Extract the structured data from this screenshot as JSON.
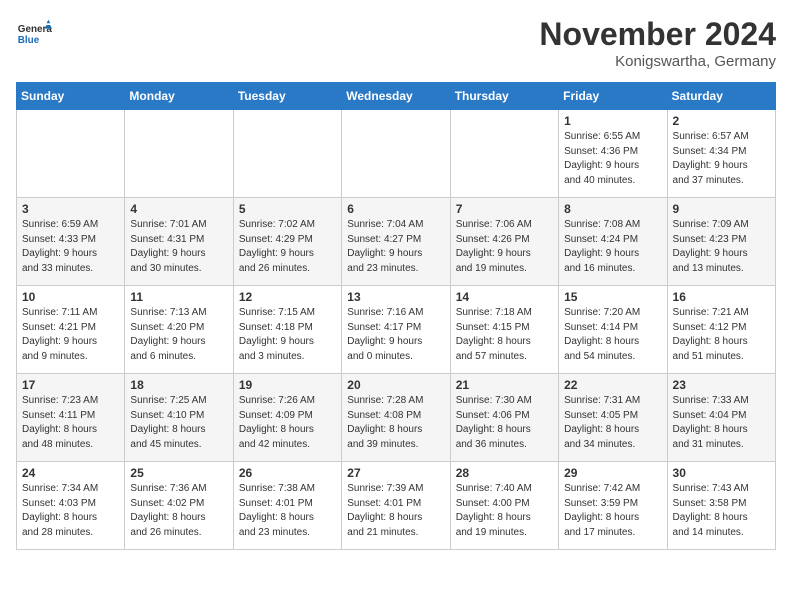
{
  "header": {
    "logo_general": "General",
    "logo_blue": "Blue",
    "month_title": "November 2024",
    "location": "Konigswartha, Germany"
  },
  "weekdays": [
    "Sunday",
    "Monday",
    "Tuesday",
    "Wednesday",
    "Thursday",
    "Friday",
    "Saturday"
  ],
  "weeks": [
    [
      {
        "day": "",
        "info": ""
      },
      {
        "day": "",
        "info": ""
      },
      {
        "day": "",
        "info": ""
      },
      {
        "day": "",
        "info": ""
      },
      {
        "day": "",
        "info": ""
      },
      {
        "day": "1",
        "info": "Sunrise: 6:55 AM\nSunset: 4:36 PM\nDaylight: 9 hours\nand 40 minutes."
      },
      {
        "day": "2",
        "info": "Sunrise: 6:57 AM\nSunset: 4:34 PM\nDaylight: 9 hours\nand 37 minutes."
      }
    ],
    [
      {
        "day": "3",
        "info": "Sunrise: 6:59 AM\nSunset: 4:33 PM\nDaylight: 9 hours\nand 33 minutes."
      },
      {
        "day": "4",
        "info": "Sunrise: 7:01 AM\nSunset: 4:31 PM\nDaylight: 9 hours\nand 30 minutes."
      },
      {
        "day": "5",
        "info": "Sunrise: 7:02 AM\nSunset: 4:29 PM\nDaylight: 9 hours\nand 26 minutes."
      },
      {
        "day": "6",
        "info": "Sunrise: 7:04 AM\nSunset: 4:27 PM\nDaylight: 9 hours\nand 23 minutes."
      },
      {
        "day": "7",
        "info": "Sunrise: 7:06 AM\nSunset: 4:26 PM\nDaylight: 9 hours\nand 19 minutes."
      },
      {
        "day": "8",
        "info": "Sunrise: 7:08 AM\nSunset: 4:24 PM\nDaylight: 9 hours\nand 16 minutes."
      },
      {
        "day": "9",
        "info": "Sunrise: 7:09 AM\nSunset: 4:23 PM\nDaylight: 9 hours\nand 13 minutes."
      }
    ],
    [
      {
        "day": "10",
        "info": "Sunrise: 7:11 AM\nSunset: 4:21 PM\nDaylight: 9 hours\nand 9 minutes."
      },
      {
        "day": "11",
        "info": "Sunrise: 7:13 AM\nSunset: 4:20 PM\nDaylight: 9 hours\nand 6 minutes."
      },
      {
        "day": "12",
        "info": "Sunrise: 7:15 AM\nSunset: 4:18 PM\nDaylight: 9 hours\nand 3 minutes."
      },
      {
        "day": "13",
        "info": "Sunrise: 7:16 AM\nSunset: 4:17 PM\nDaylight: 9 hours\nand 0 minutes."
      },
      {
        "day": "14",
        "info": "Sunrise: 7:18 AM\nSunset: 4:15 PM\nDaylight: 8 hours\nand 57 minutes."
      },
      {
        "day": "15",
        "info": "Sunrise: 7:20 AM\nSunset: 4:14 PM\nDaylight: 8 hours\nand 54 minutes."
      },
      {
        "day": "16",
        "info": "Sunrise: 7:21 AM\nSunset: 4:12 PM\nDaylight: 8 hours\nand 51 minutes."
      }
    ],
    [
      {
        "day": "17",
        "info": "Sunrise: 7:23 AM\nSunset: 4:11 PM\nDaylight: 8 hours\nand 48 minutes."
      },
      {
        "day": "18",
        "info": "Sunrise: 7:25 AM\nSunset: 4:10 PM\nDaylight: 8 hours\nand 45 minutes."
      },
      {
        "day": "19",
        "info": "Sunrise: 7:26 AM\nSunset: 4:09 PM\nDaylight: 8 hours\nand 42 minutes."
      },
      {
        "day": "20",
        "info": "Sunrise: 7:28 AM\nSunset: 4:08 PM\nDaylight: 8 hours\nand 39 minutes."
      },
      {
        "day": "21",
        "info": "Sunrise: 7:30 AM\nSunset: 4:06 PM\nDaylight: 8 hours\nand 36 minutes."
      },
      {
        "day": "22",
        "info": "Sunrise: 7:31 AM\nSunset: 4:05 PM\nDaylight: 8 hours\nand 34 minutes."
      },
      {
        "day": "23",
        "info": "Sunrise: 7:33 AM\nSunset: 4:04 PM\nDaylight: 8 hours\nand 31 minutes."
      }
    ],
    [
      {
        "day": "24",
        "info": "Sunrise: 7:34 AM\nSunset: 4:03 PM\nDaylight: 8 hours\nand 28 minutes."
      },
      {
        "day": "25",
        "info": "Sunrise: 7:36 AM\nSunset: 4:02 PM\nDaylight: 8 hours\nand 26 minutes."
      },
      {
        "day": "26",
        "info": "Sunrise: 7:38 AM\nSunset: 4:01 PM\nDaylight: 8 hours\nand 23 minutes."
      },
      {
        "day": "27",
        "info": "Sunrise: 7:39 AM\nSunset: 4:01 PM\nDaylight: 8 hours\nand 21 minutes."
      },
      {
        "day": "28",
        "info": "Sunrise: 7:40 AM\nSunset: 4:00 PM\nDaylight: 8 hours\nand 19 minutes."
      },
      {
        "day": "29",
        "info": "Sunrise: 7:42 AM\nSunset: 3:59 PM\nDaylight: 8 hours\nand 17 minutes."
      },
      {
        "day": "30",
        "info": "Sunrise: 7:43 AM\nSunset: 3:58 PM\nDaylight: 8 hours\nand 14 minutes."
      }
    ]
  ]
}
